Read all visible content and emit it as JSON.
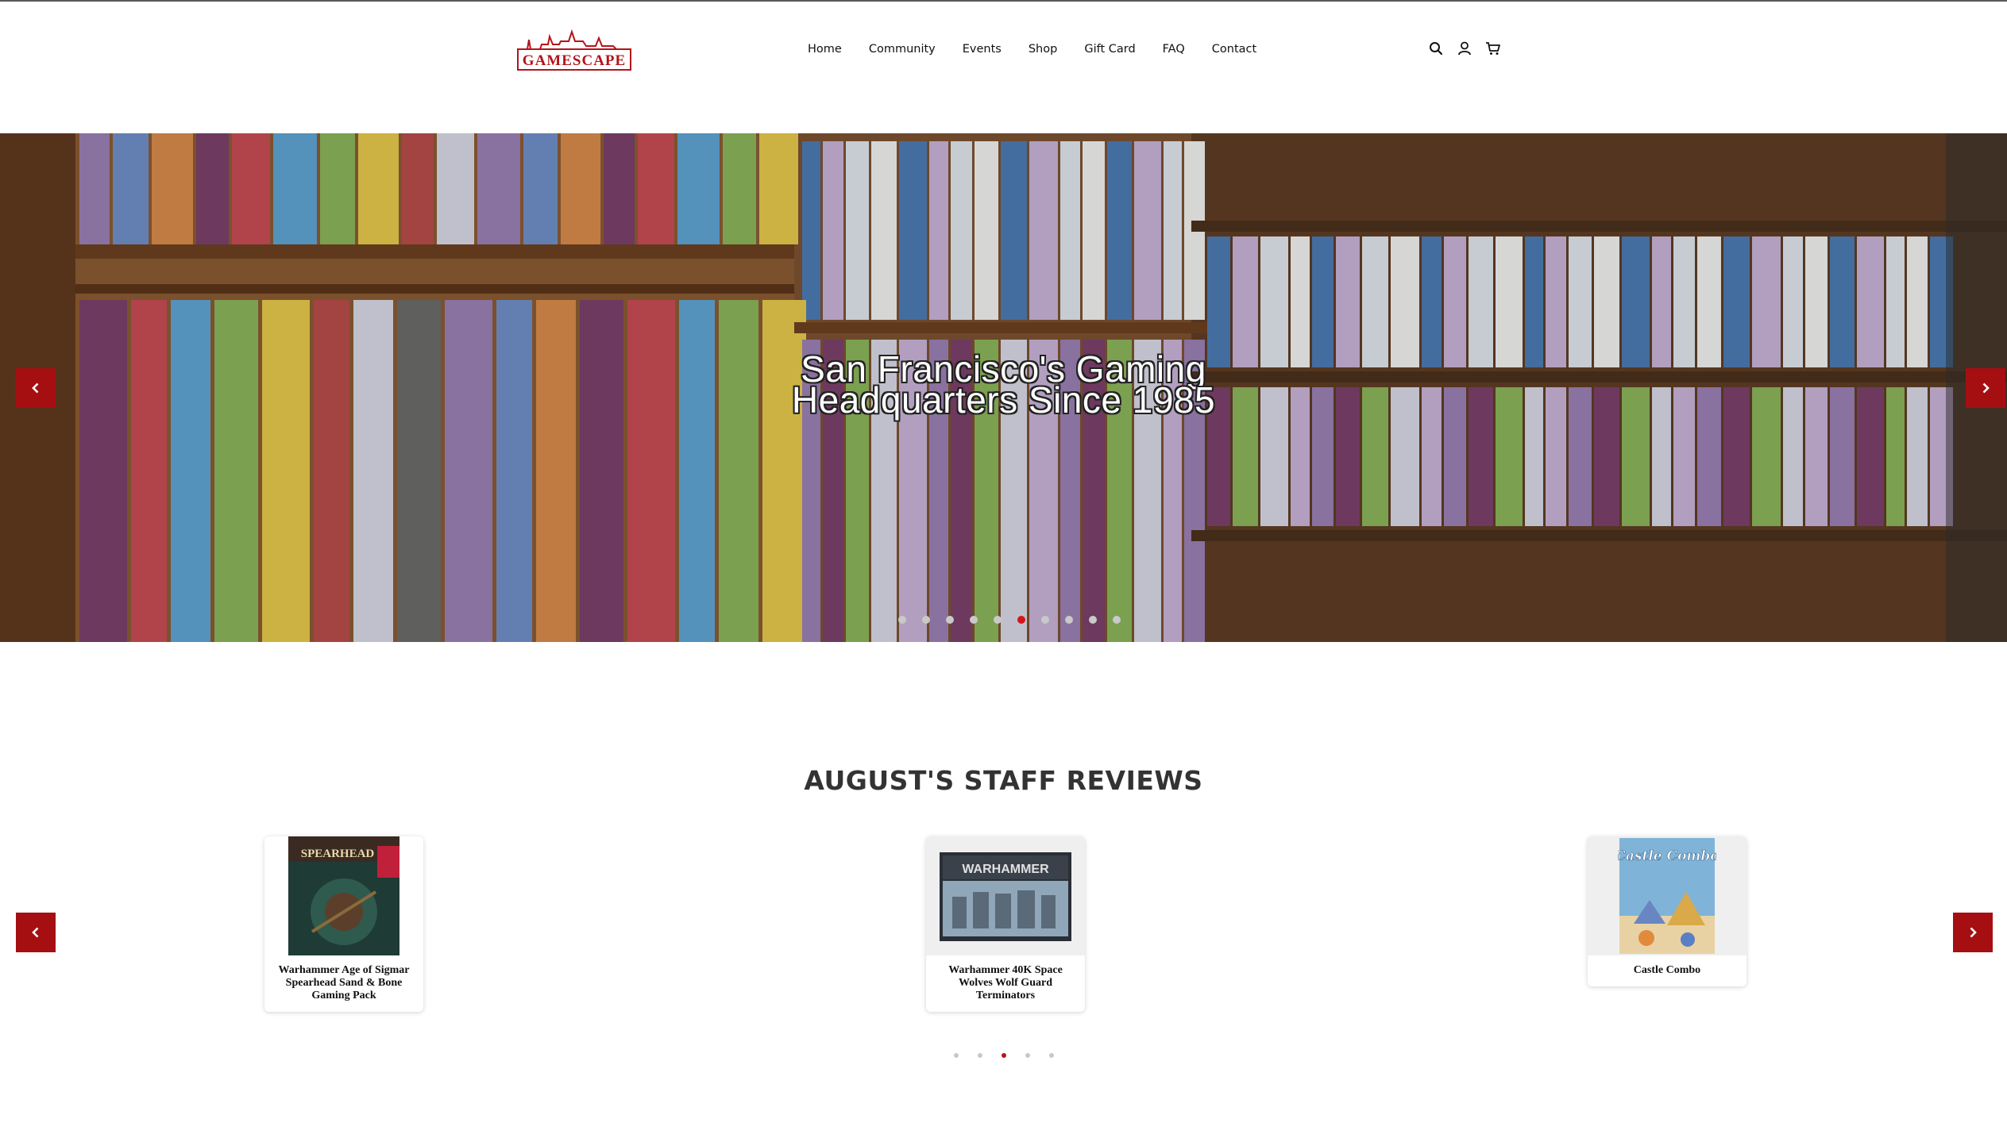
{
  "brand": {
    "logo_text": "GAMESCAPE",
    "accent": "#a50f12"
  },
  "nav": {
    "items": [
      "Home",
      "Community",
      "Events",
      "Shop",
      "Gift Card",
      "FAQ",
      "Contact"
    ]
  },
  "header_icons": [
    "search-icon",
    "account-icon",
    "cart-icon"
  ],
  "hero": {
    "title_line1": "San Francisco's Gaming",
    "title_line2": "Headquarters Since 1985",
    "slide_count": 10,
    "active_slide": 6
  },
  "reviews": {
    "title": "AUGUST'S STAFF REVIEWS",
    "items": [
      {
        "name": "Warhammer Age of Sigmar Spearhead Sand & Bone Gaming Pack",
        "box_text": "SPEARHEAD"
      },
      {
        "name": "Warhammer 40K Space Wolves Wolf Guard Terminators",
        "box_text": "WARHAMMER"
      },
      {
        "name": "Castle Combo",
        "box_text": "Castle Combo"
      }
    ],
    "page_count": 5,
    "active_page": 3
  }
}
